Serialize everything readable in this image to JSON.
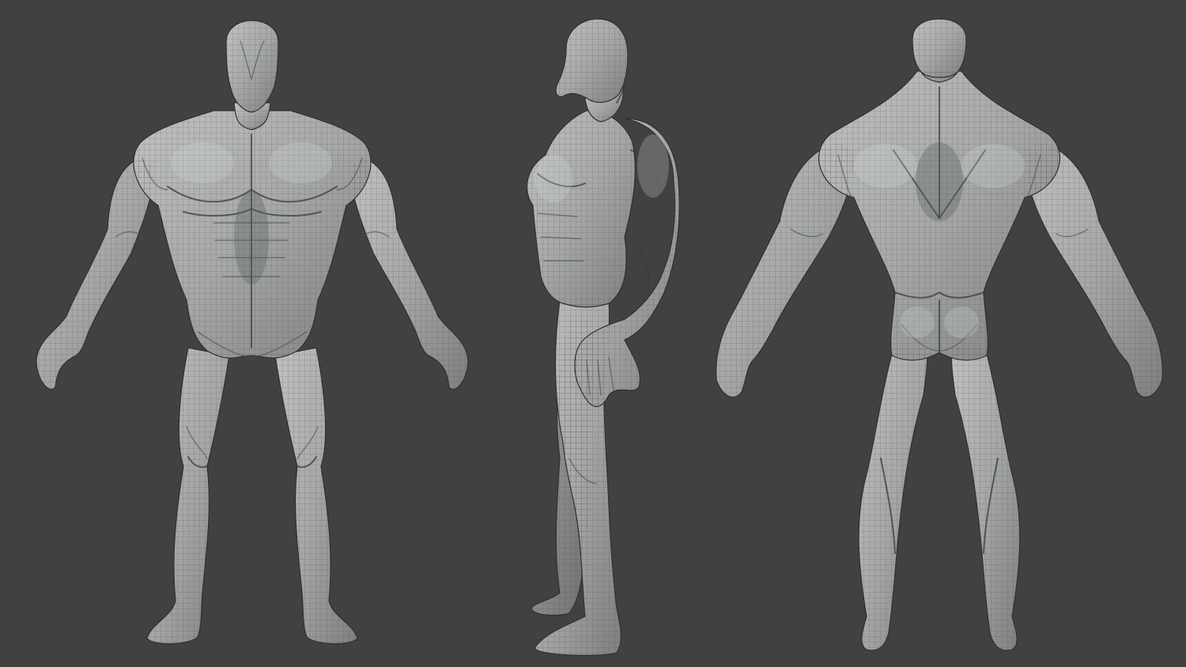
{
  "scene": {
    "background_color": "#414141",
    "model_color": "#a8aaaa",
    "wire_color": "#3c3e3e",
    "views": [
      {
        "id": "front",
        "label": ""
      },
      {
        "id": "side",
        "label": ""
      },
      {
        "id": "back",
        "label": ""
      }
    ]
  }
}
